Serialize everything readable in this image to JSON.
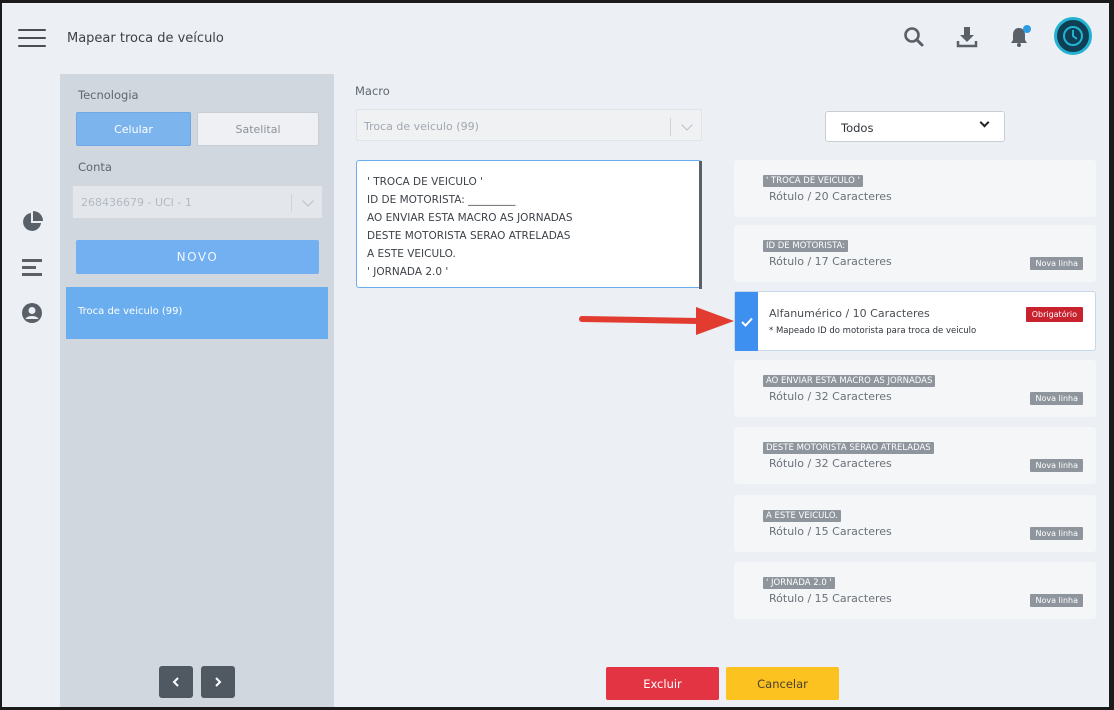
{
  "header": {
    "title": "Mapear troca de veículo"
  },
  "left_panel": {
    "tecnologia_label": "Tecnologia",
    "celular_label": "Celular",
    "satelital_label": "Satelital",
    "conta_label": "Conta",
    "conta_value": "268436679 - UCI - 1",
    "novo_label": "NOVO",
    "items": [
      {
        "label": "Troca de veiculo  (99)"
      }
    ]
  },
  "macro": {
    "label": "Macro",
    "value": "Troca de veiculo (99)",
    "preview_lines": [
      "' TROCA DE VEICULO '",
      "ID DE MOTORISTA: _________",
      "AO ENVIAR ESTA MACRO AS JORNADAS",
      "DESTE MOTORISTA SERAO ATRELADAS",
      "A ESTE VEICULO.",
      "' JORNADA 2.0 '"
    ]
  },
  "filter": {
    "value": "Todos"
  },
  "fields": [
    {
      "tag": "' TROCA DE VEICULO '",
      "meta": "Rótulo / 20 Caracteres",
      "badge": ""
    },
    {
      "tag": "ID DE MOTORISTA:",
      "meta": "Rótulo / 17 Caracteres",
      "badge": "Nova linha"
    },
    {
      "meta": "Alfanumérico / 10 Caracteres",
      "desc": "* Mapeado ID do motorista para troca de veiculo",
      "badge": "Obrigatório"
    },
    {
      "tag": "AO ENVIAR ESTA MACRO AS JORNADAS",
      "meta": "Rótulo / 32 Caracteres",
      "badge": "Nova linha"
    },
    {
      "tag": "DESTE MOTORISTA SERAO ATRELADAS",
      "meta": "Rótulo / 32 Caracteres",
      "badge": "Nova linha"
    },
    {
      "tag": "A ESTE VEICULO.",
      "meta": "Rótulo / 15 Caracteres",
      "badge": "Nova linha"
    },
    {
      "tag": "' JORNADA 2.0 '",
      "meta": "Rótulo / 15 Caracteres",
      "badge": "Nova linha"
    }
  ],
  "actions": {
    "excluir": "Excluir",
    "cancelar": "Cancelar"
  },
  "colors": {
    "primary": "#3d8ff0",
    "danger": "#e33444",
    "warning": "#fcc21f",
    "required": "#c8222e"
  }
}
